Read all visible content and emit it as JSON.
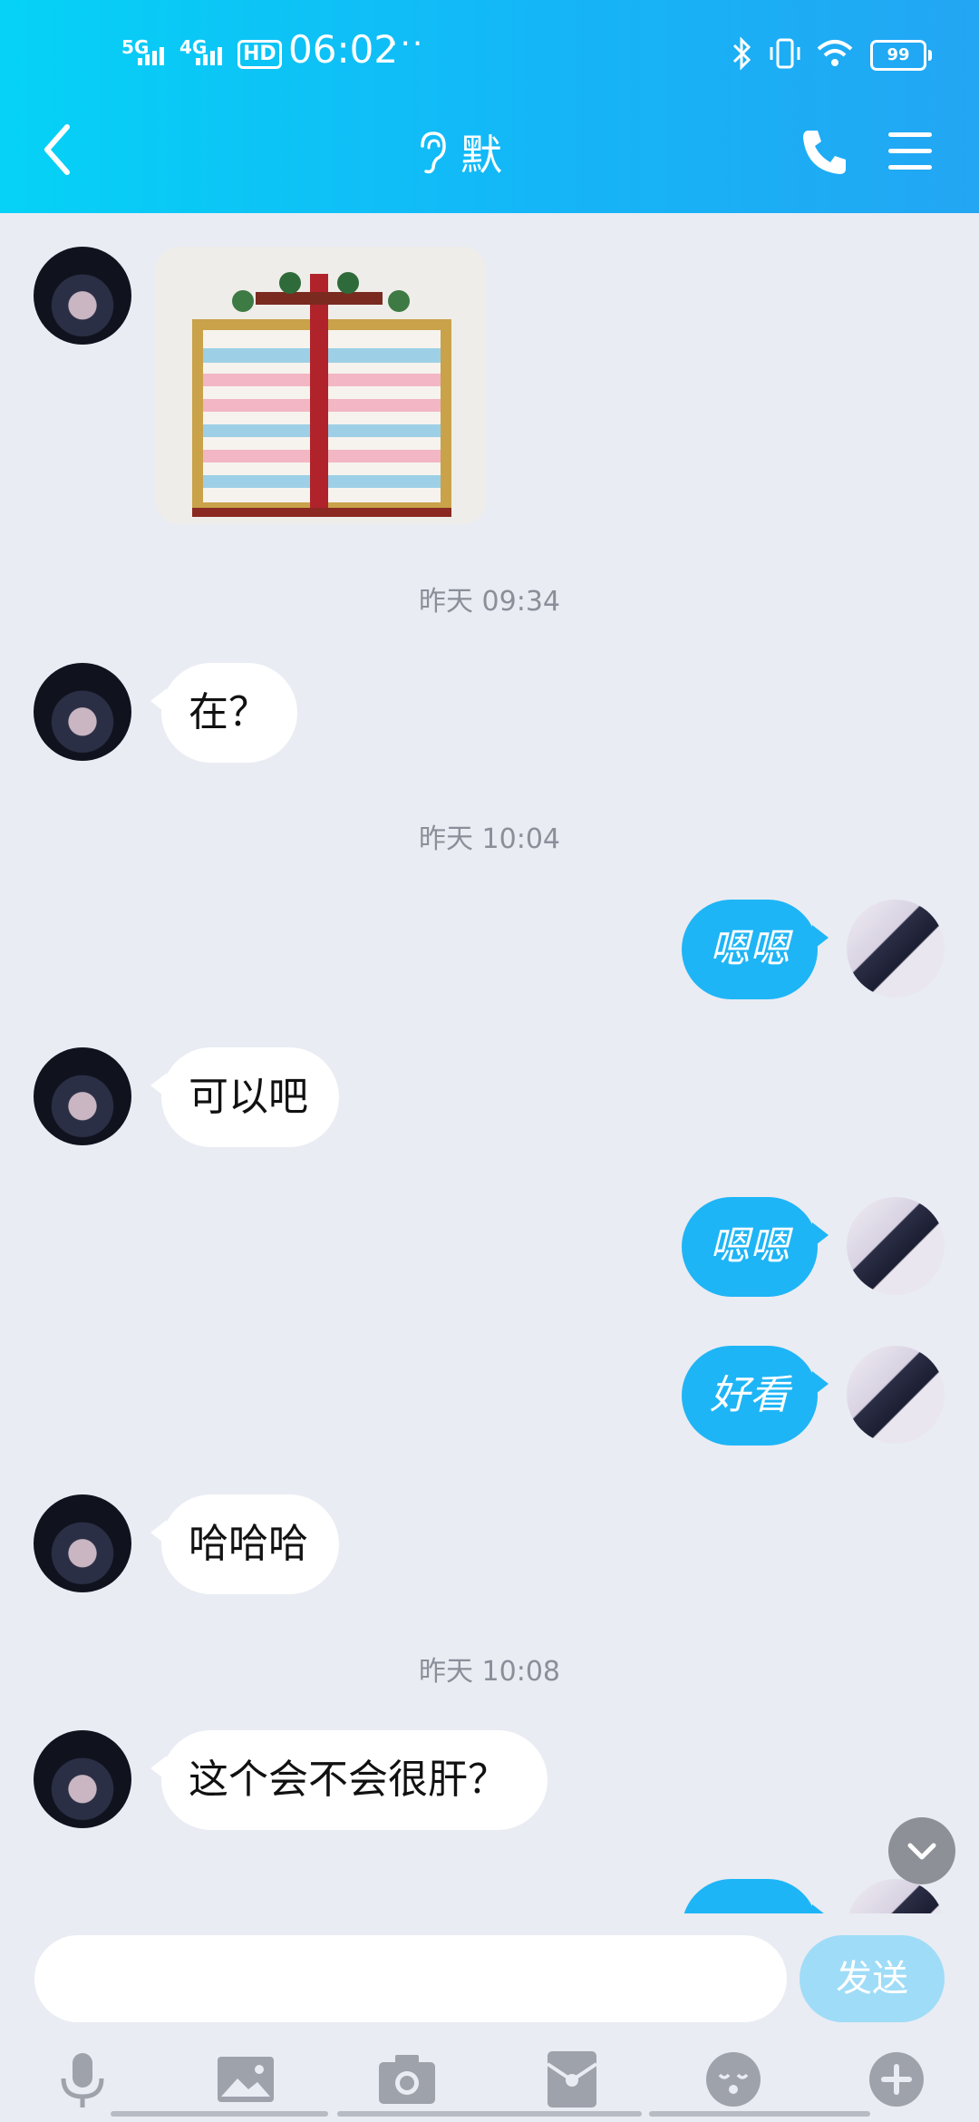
{
  "status_bar": {
    "net1": "5G",
    "net2": "4G",
    "hd": "HD",
    "time": "06:02",
    "more": "···",
    "battery": "99"
  },
  "header": {
    "title": "默",
    "back_icon": "chevron-left-icon",
    "ear_icon": "ear-icon",
    "call_icon": "phone-icon",
    "menu_icon": "menu-icon"
  },
  "messages": {
    "ts1": "昨天 09:34",
    "ts2": "昨天 10:04",
    "ts3": "昨天 10:08",
    "m1": "在？",
    "m2": "嗯嗯",
    "m3": "可以吧",
    "m4": "嗯嗯",
    "m5": "好看",
    "m6": "哈哈哈",
    "m7": "这个会不会很肝？"
  },
  "input": {
    "placeholder": "",
    "send_label": "发送"
  },
  "colors": {
    "header_start": "#05d2f6",
    "header_end": "#23a6f3",
    "outgoing_bubble": "#1eb5f6",
    "background": "#e9ecf3"
  }
}
